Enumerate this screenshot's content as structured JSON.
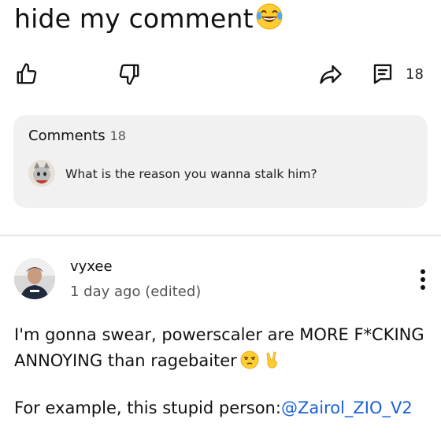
{
  "post": {
    "text_tail": "hide my comment",
    "emoji": "face-with-tears-of-joy"
  },
  "actions": {
    "like_icon": "thumbs-up-icon",
    "dislike_icon": "thumbs-down-icon",
    "share_icon": "share-icon",
    "comments_icon": "comment-icon",
    "comments_count": "18"
  },
  "comments_panel": {
    "title": "Comments",
    "count": "18",
    "preview_text": "What is the reason you wanna stalk him?"
  },
  "comment": {
    "username": "vyxee",
    "timestamp": "1 day ago (edited)",
    "line1": "I'm gonna swear, powerscaler are MORE F*CKING",
    "line2": "ANNOYING than ragebaiter",
    "line2_emojis": [
      "unamused-face",
      "victory-hand"
    ],
    "line3_prefix": "For example, this stupid person:",
    "mention": "@Zairol_ZIO_V2"
  },
  "colors": {
    "text": "#111111",
    "muted": "#555555",
    "card_bg": "#f1f1f1",
    "link": "#1a5fd6"
  }
}
